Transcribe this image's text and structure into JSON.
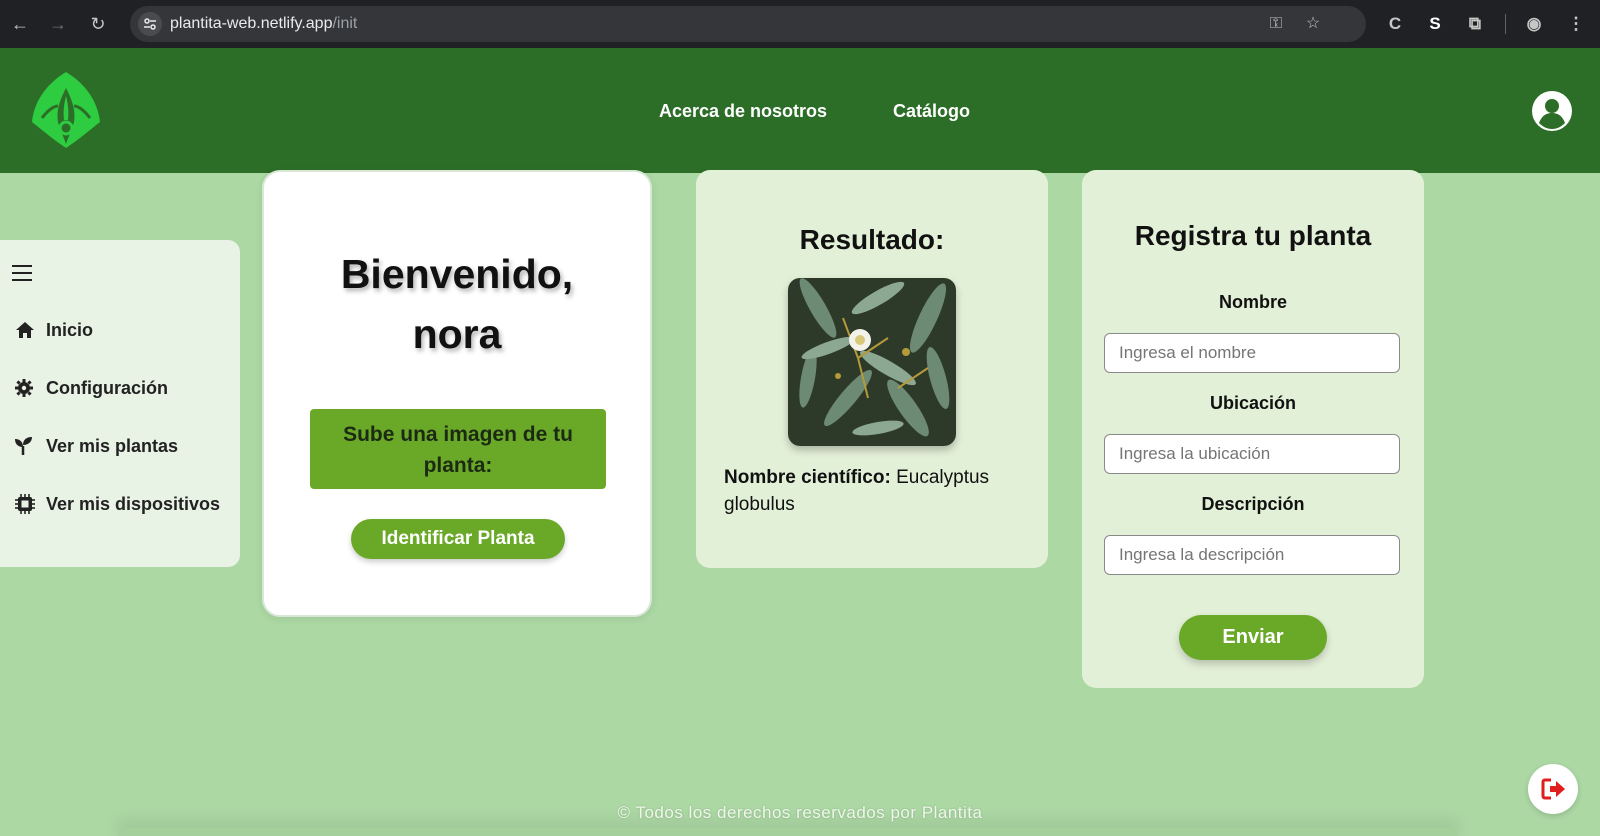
{
  "browser": {
    "url_host": "plantita-web.netlify.app",
    "url_path": "/init"
  },
  "header": {
    "nav": [
      "Acerca de nosotros",
      "Catálogo"
    ]
  },
  "sidebar": {
    "items": [
      {
        "label": "Inicio",
        "icon": "home-icon"
      },
      {
        "label": "Configuración",
        "icon": "gear-icon"
      },
      {
        "label": "Ver mis plantas",
        "icon": "sprout-icon"
      },
      {
        "label": "Ver mis dispositivos",
        "icon": "chip-icon"
      }
    ]
  },
  "welcome": {
    "greeting": "Bienvenido,",
    "username": "nora",
    "upload_label": "Sube una imagen de tu planta:",
    "identify_button": "Identificar Planta"
  },
  "result": {
    "title": "Resultado:",
    "scientific_label": "Nombre científico:",
    "scientific_value": "Eucalyptus globulus"
  },
  "register": {
    "title": "Registra tu planta",
    "fields": [
      {
        "label": "Nombre",
        "placeholder": "Ingresa el nombre"
      },
      {
        "label": "Ubicación",
        "placeholder": "Ingresa la ubicación"
      },
      {
        "label": "Descripción",
        "placeholder": "Ingresa la descripción"
      }
    ],
    "submit": "Enviar"
  },
  "footer": {
    "text": "© Todos los derechos reservados por Plantita"
  },
  "colors": {
    "header": "#2c6e28",
    "background": "#acd8a4",
    "accent": "#6aa928",
    "card": "#e3f0d8"
  }
}
